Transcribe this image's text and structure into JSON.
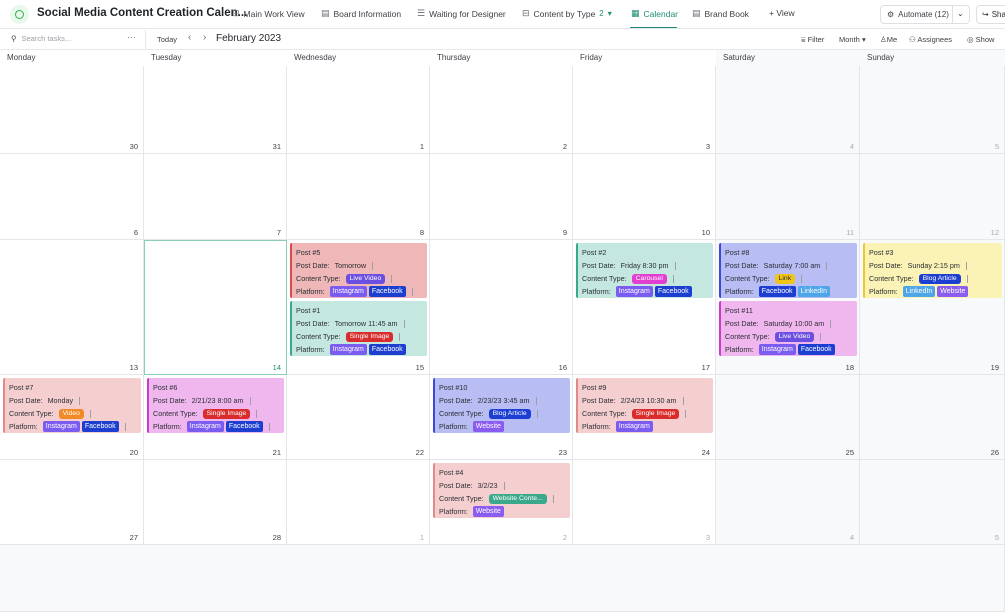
{
  "app": {
    "title": "Social Media Content Creation Calen..."
  },
  "tabs": [
    {
      "label": "Main Work View",
      "icon": "board-icon"
    },
    {
      "label": "Board Information",
      "icon": "doc-icon"
    },
    {
      "label": "Waiting for Designer",
      "icon": "list-icon"
    },
    {
      "label": "Content by Type",
      "icon": "board-icon",
      "count": "2"
    },
    {
      "label": "Calendar",
      "icon": "calendar-icon",
      "active": true
    },
    {
      "label": "Brand Book",
      "icon": "doc-icon"
    },
    {
      "label": "+ View",
      "icon": "plus-icon"
    }
  ],
  "automate": {
    "label": "Automate (12)"
  },
  "share": {
    "label": "Share"
  },
  "toolbar": {
    "search_placeholder": "Search tasks...",
    "today": "Today",
    "month": "February 2023",
    "filter": "Filter",
    "view_mode": "Month",
    "me": "Me",
    "assignees": "Assignees",
    "show": "Show"
  },
  "days": [
    "Monday",
    "Tuesday",
    "Wednesday",
    "Thursday",
    "Friday",
    "Saturday",
    "Sunday"
  ],
  "weeks": [
    [
      {
        "d": "30"
      },
      {
        "d": "31"
      },
      {
        "d": "1"
      },
      {
        "d": "2"
      },
      {
        "d": "3"
      },
      {
        "d": "4",
        "m": true
      },
      {
        "d": "5",
        "m": true
      }
    ],
    [
      {
        "d": "6"
      },
      {
        "d": "7"
      },
      {
        "d": "8"
      },
      {
        "d": "9"
      },
      {
        "d": "10"
      },
      {
        "d": "11",
        "m": true
      },
      {
        "d": "12",
        "m": true
      }
    ],
    [
      {
        "d": "13"
      },
      {
        "d": "14",
        "today": true
      },
      {
        "d": "15"
      },
      {
        "d": "16"
      },
      {
        "d": "17"
      },
      {
        "d": "18"
      },
      {
        "d": "19"
      }
    ],
    [
      {
        "d": "20"
      },
      {
        "d": "21"
      },
      {
        "d": "22"
      },
      {
        "d": "23"
      },
      {
        "d": "24"
      },
      {
        "d": "25"
      },
      {
        "d": "26"
      }
    ],
    [
      {
        "d": "27"
      },
      {
        "d": "28"
      },
      {
        "d": "1",
        "m": true
      },
      {
        "d": "2",
        "m": true
      },
      {
        "d": "3",
        "m": true
      },
      {
        "d": "4",
        "m": true
      },
      {
        "d": "5",
        "m": true
      }
    ]
  ],
  "labels": {
    "post_date": "Post Date:",
    "content_type": "Content Type:",
    "platform": "Platform:"
  },
  "colors": {
    "instagram": "#7b5cf0",
    "facebook": "#1d3fd1",
    "linkedin": "#4ea6e8",
    "website": "#8a5cf0",
    "live_video": "#6b4fe0",
    "single_image": "#d92d2d",
    "carousel": "#e23fd1",
    "link": "#f0c419",
    "blog_article": "#1d3fd1",
    "video": "#f08a24",
    "website_content": "#3aa88a"
  },
  "posts": [
    {
      "id": "p5",
      "week": 2,
      "day": 2,
      "slot": 0,
      "title": "Post #5",
      "date": "Tomorrow",
      "type": "Live Video",
      "type_color": "#6b4fe0",
      "type_text": "#fff",
      "bg": "#efb7b7",
      "border": "#d94a4a",
      "platforms": [
        {
          "n": "Instagram",
          "c": "#7b5cf0"
        },
        {
          "n": "Facebook",
          "c": "#1d3fd1"
        }
      ],
      "trail": true
    },
    {
      "id": "p1",
      "week": 2,
      "day": 2,
      "slot": 1,
      "title": "Post #1",
      "date": "Tomorrow 11:45 am",
      "type": "Single Image",
      "type_color": "#d92d2d",
      "type_text": "#fff",
      "bg": "#c4e8df",
      "border": "#3aa88a",
      "platforms": [
        {
          "n": "Instagram",
          "c": "#7b5cf0"
        },
        {
          "n": "Facebook",
          "c": "#1d3fd1"
        }
      ]
    },
    {
      "id": "p2",
      "week": 2,
      "day": 4,
      "slot": 0,
      "title": "Post #2",
      "date": "Friday 8:30 pm",
      "type": "Carousel",
      "type_color": "#e23fd1",
      "type_text": "#fff",
      "bg": "#c4e8df",
      "border": "#3aa88a",
      "platforms": [
        {
          "n": "Instagram",
          "c": "#7b5cf0"
        },
        {
          "n": "Facebook",
          "c": "#1d3fd1"
        }
      ]
    },
    {
      "id": "p8",
      "week": 2,
      "day": 5,
      "slot": 0,
      "title": "Post #8",
      "date": "Saturday 7:00 am",
      "type": "Link",
      "type_color": "#f0c419",
      "type_text": "#2a2e34",
      "bg": "#b8bdf3",
      "border": "#3b48d8",
      "platforms": [
        {
          "n": "Facebook",
          "c": "#1d3fd1"
        },
        {
          "n": "LinkedIn",
          "c": "#4ea6e8"
        }
      ]
    },
    {
      "id": "p11",
      "week": 2,
      "day": 5,
      "slot": 1,
      "title": "Post #11",
      "date": "Saturday 10:00 am",
      "type": "Live Video",
      "type_color": "#6b4fe0",
      "type_text": "#fff",
      "bg": "#f0b6ee",
      "border": "#c93bc9",
      "platforms": [
        {
          "n": "Instagram",
          "c": "#7b5cf0"
        },
        {
          "n": "Facebook",
          "c": "#1d3fd1"
        }
      ]
    },
    {
      "id": "p3",
      "week": 2,
      "day": 6,
      "slot": 0,
      "title": "Post #3",
      "date": "Sunday 2:15 pm",
      "type": "Blog Article",
      "type_color": "#1d3fd1",
      "type_text": "#fff",
      "bg": "#faf3b5",
      "border": "#e7cb2e",
      "platforms": [
        {
          "n": "LinkedIn",
          "c": "#4ea6e8"
        },
        {
          "n": "Website",
          "c": "#8a5cf0"
        }
      ]
    },
    {
      "id": "p7",
      "week": 3,
      "day": 0,
      "slot": 0,
      "title": "Post #7",
      "date": "Monday",
      "type": "Video",
      "type_color": "#f08a24",
      "type_text": "#fff",
      "bg": "#f5cfcf",
      "border": "#e08a8a",
      "platforms": [
        {
          "n": "Instagram",
          "c": "#7b5cf0"
        },
        {
          "n": "Facebook",
          "c": "#1d3fd1"
        }
      ],
      "trail": true
    },
    {
      "id": "p6",
      "week": 3,
      "day": 1,
      "slot": 0,
      "title": "Post #6",
      "date": "2/21/23 8:00 am",
      "type": "Single Image",
      "type_color": "#d92d2d",
      "type_text": "#fff",
      "bg": "#f0b6ee",
      "border": "#c93bc9",
      "platforms": [
        {
          "n": "Instagram",
          "c": "#7b5cf0"
        },
        {
          "n": "Facebook",
          "c": "#1d3fd1"
        }
      ],
      "trail": true
    },
    {
      "id": "p10",
      "week": 3,
      "day": 3,
      "slot": 0,
      "title": "Post #10",
      "date": "2/23/23 3:45 am",
      "type": "Blog Article",
      "type_color": "#1d3fd1",
      "type_text": "#fff",
      "bg": "#b8bdf3",
      "border": "#3b48d8",
      "platforms": [
        {
          "n": "Website",
          "c": "#8a5cf0"
        }
      ]
    },
    {
      "id": "p9",
      "week": 3,
      "day": 4,
      "slot": 0,
      "title": "Post #9",
      "date": "2/24/23 10:30 am",
      "type": "Single Image",
      "type_color": "#d92d2d",
      "type_text": "#fff",
      "bg": "#f5cfcf",
      "border": "#e08a8a",
      "platforms": [
        {
          "n": "Instagram",
          "c": "#7b5cf0"
        }
      ]
    },
    {
      "id": "p4",
      "week": 4,
      "day": 3,
      "slot": 0,
      "title": "Post #4",
      "date": "3/2/23",
      "type": "Website Conte...",
      "type_color": "#3aa88a",
      "type_text": "#fff",
      "bg": "#f5cfcf",
      "border": "#e08a8a",
      "platforms": [
        {
          "n": "Website",
          "c": "#8a5cf0"
        }
      ]
    }
  ]
}
